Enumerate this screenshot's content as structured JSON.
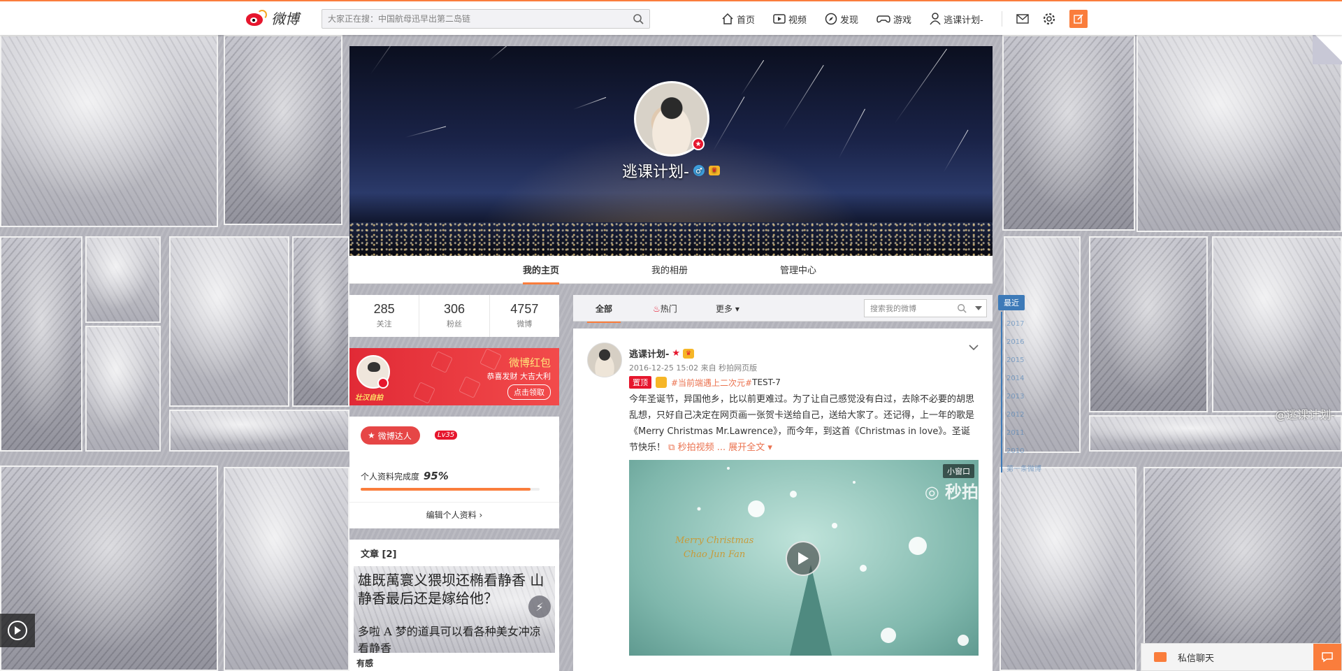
{
  "topbar": {
    "logo_text": "微博",
    "search_placeholder": "大家正在搜：中国航母迅早出第二岛链",
    "nav": [
      {
        "label": "首页",
        "icon": "home-icon"
      },
      {
        "label": "视频",
        "icon": "video-icon"
      },
      {
        "label": "发现",
        "icon": "compass-icon"
      },
      {
        "label": "游戏",
        "icon": "gamepad-icon"
      },
      {
        "label": "逃课计划-",
        "icon": "user-icon"
      }
    ],
    "accent": "#fa7d3c"
  },
  "profile": {
    "name": "逃课计划-",
    "gender_symbol": "♂",
    "tabs": [
      "我的主页",
      "我的相册",
      "管理中心"
    ],
    "active_tab": "我的主页"
  },
  "stats": [
    {
      "value": "285",
      "label": "关注"
    },
    {
      "value": "306",
      "label": "粉丝"
    },
    {
      "value": "4757",
      "label": "微博"
    }
  ],
  "redpack": {
    "tag": "壮汉自拍",
    "title": "微博红包",
    "subtitle": "恭喜发财 大吉大利",
    "button": "点击领取"
  },
  "userinfo": {
    "daren_label": "微博达人",
    "level": "Lv35",
    "completeness_label": "个人资料完成度",
    "completeness_value": "95%",
    "completeness_fraction": 0.95,
    "edit_label": "编辑个人资料"
  },
  "articles": {
    "header": "文章 [2]",
    "line1": "雄既萬寰义猥坝还椭看静香 山",
    "line2": "静香最后还是嫁给他？",
    "line3": "多啦 A 梦的道具可以看各种美女冲凉",
    "line4": "看静香",
    "footer": "有感"
  },
  "feed": {
    "tabs": [
      "全部",
      "热门",
      "更多"
    ],
    "search_placeholder": "搜索我的微博",
    "post": {
      "author": "逃课计划-",
      "meta": "2016-12-25 15:02 来自 秒拍网页版",
      "top_label": "置顶",
      "topic": "#当前端遇上二次元#",
      "topic_suffix": "TEST-7",
      "text": "今年圣诞节，异国他乡，比以前更难过。为了让自己感觉没有白过，去除不必要的胡思乱想，只好自己决定在网页画一张贺卡送给自己，送给大家了。还记得，上一年的歌是《Merry Christmas Mr.Lawrence》，而今年，到这首《Christmas in love》。圣诞节快乐！",
      "video_link": "秒拍视频",
      "expand_link": "... 展开全文",
      "video": {
        "mini_label": "小窗口",
        "watermark": "秒拍",
        "card_line1": "Merry Christmas",
        "card_line2": "Chao Jun Fan"
      }
    }
  },
  "timeline": {
    "current": "最近",
    "years": [
      "2017",
      "2016",
      "2015",
      "2014",
      "2013",
      "2012",
      "2011",
      "2010"
    ],
    "first": "第一条微博"
  },
  "background": {
    "watermark": "@逃课计划-"
  },
  "chat": {
    "label": "私信聊天"
  }
}
